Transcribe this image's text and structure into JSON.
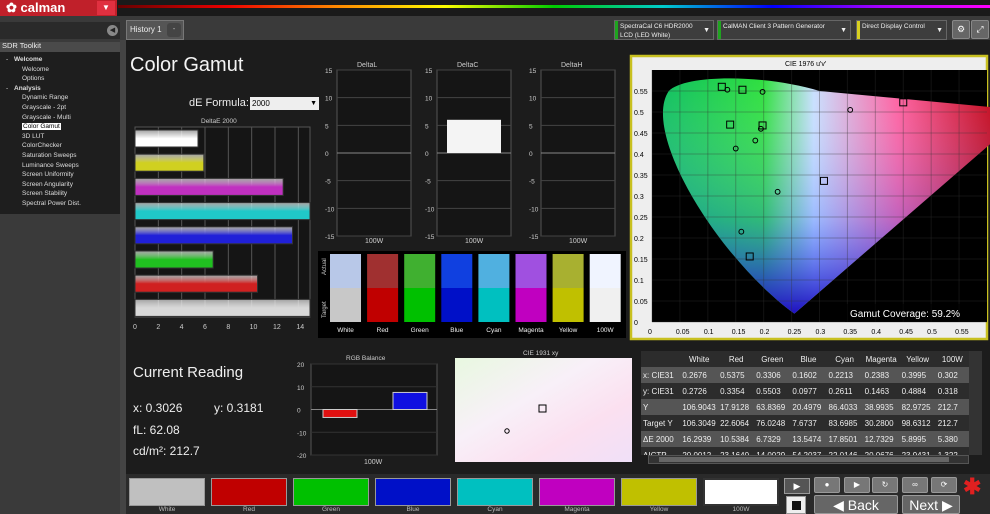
{
  "app": {
    "name": "calman"
  },
  "header": {
    "tab": "History 1",
    "tab_close": "-",
    "devices": [
      {
        "line1": "SpectraCal C6 HDR2000",
        "line2": "LCD (LED White)",
        "color": "#1fa31f"
      },
      {
        "line1": "CalMAN Client 3 Pattern Generator",
        "line2": "",
        "color": "#1fa31f"
      },
      {
        "line1": "Direct Display Control",
        "line2": "",
        "color": "#d8d020"
      }
    ]
  },
  "sidebar": {
    "title": "SDR Toolkit",
    "items": [
      {
        "label": "Welcome",
        "level": 0,
        "bold": true
      },
      {
        "label": "Welcome",
        "level": 1
      },
      {
        "label": "Options",
        "level": 1
      },
      {
        "label": "Analysis",
        "level": 0,
        "bold": true
      },
      {
        "label": "Dynamic Range",
        "level": 1
      },
      {
        "label": "Grayscale - 2pt",
        "level": 1
      },
      {
        "label": "Grayscale - Multi",
        "level": 1
      },
      {
        "label": "Color Gamut",
        "level": 1,
        "selected": true
      },
      {
        "label": "3D LUT",
        "level": 1
      },
      {
        "label": "ColorChecker",
        "level": 1
      },
      {
        "label": "Saturation Sweeps",
        "level": 1
      },
      {
        "label": "Luminance Sweeps",
        "level": 1
      },
      {
        "label": "Screen Uniformity",
        "level": 1
      },
      {
        "label": "Screen Angularity",
        "level": 1
      },
      {
        "label": "Screen Stability",
        "level": 1
      },
      {
        "label": "Spectral Power Dist.",
        "level": 1
      }
    ]
  },
  "page": {
    "title": "Color Gamut",
    "de_formula_label": "dE Formula:",
    "de_formula_value": "2000"
  },
  "charts": {
    "deltae": {
      "title": "DeltaE 2000",
      "ticks": [
        "0",
        "2",
        "4",
        "6",
        "8",
        "10",
        "12",
        "14"
      ],
      "xlim": [
        0,
        15
      ],
      "bars": [
        {
          "v": 5.4,
          "c": "#ffffff"
        },
        {
          "v": 5.9,
          "c": "#d0d020"
        },
        {
          "v": 12.7,
          "c": "#c030c0"
        },
        {
          "v": 17.9,
          "c": "#20c8c8"
        },
        {
          "v": 13.5,
          "c": "#2020d8"
        },
        {
          "v": 6.7,
          "c": "#20c020"
        },
        {
          "v": 10.5,
          "c": "#d02020"
        },
        {
          "v": 16.3,
          "c": "#d8d8d8"
        }
      ]
    },
    "delta_small": [
      {
        "title": "DeltaL",
        "xlabel": "100W",
        "value": 0
      },
      {
        "title": "DeltaC",
        "xlabel": "100W",
        "value": 6
      },
      {
        "title": "DeltaH",
        "xlabel": "100W",
        "value": 0
      }
    ],
    "delta_ticks": [
      "15",
      "10",
      "5",
      "0",
      "-5",
      "-10",
      "-15"
    ],
    "rgb": {
      "title": "RGB Balance",
      "xlabel": "100W",
      "ticks": [
        "20",
        "10",
        "0",
        "-10",
        "-20"
      ],
      "bars": [
        {
          "v": -3.5,
          "c": "#e01010"
        },
        {
          "v": 7.5,
          "c": "#1010e0"
        }
      ]
    },
    "cie1976": {
      "title": "CIE 1976 u'v'",
      "xticks": [
        "0",
        "0.05",
        "0.1",
        "0.15",
        "0.2",
        "0.25",
        "0.3",
        "0.35",
        "0.4",
        "0.45",
        "0.5",
        "0.55"
      ],
      "yticks": [
        "0.55",
        "0.5",
        "0.45",
        "0.4",
        "0.35",
        "0.3",
        "0.25",
        "0.2",
        "0.15",
        "0.1",
        "0.05",
        "0"
      ],
      "coverage_label": "Gamut Coverage:",
      "coverage_value": "59.2%"
    },
    "cie1931": {
      "title": "CIE 1931 xy"
    }
  },
  "swatch_compare": {
    "actual_label": "Actual",
    "target_label": "Target",
    "items": [
      {
        "label": "White",
        "actual": "#b8c8e8",
        "target": "#c8c8c8"
      },
      {
        "label": "Red",
        "actual": "#a03030",
        "target": "#c00000"
      },
      {
        "label": "Green",
        "actual": "#40b030",
        "target": "#00c000"
      },
      {
        "label": "Blue",
        "actual": "#1040e0",
        "target": "#0010c8"
      },
      {
        "label": "Cyan",
        "actual": "#50b0e0",
        "target": "#00c0c0"
      },
      {
        "label": "Magenta",
        "actual": "#a050e0",
        "target": "#c000c0"
      },
      {
        "label": "Yellow",
        "actual": "#a8b030",
        "target": "#c0c000"
      },
      {
        "label": "100W",
        "actual": "#f0f4ff",
        "target": "#f0f0f0"
      }
    ]
  },
  "reading": {
    "title": "Current Reading",
    "x": "x: 0.3026",
    "y": "y: 0.3181",
    "fl": "fL: 62.08",
    "cdm": "cd/m²: 212.7"
  },
  "table": {
    "headers": [
      "",
      "White",
      "Red",
      "Green",
      "Blue",
      "Cyan",
      "Magenta",
      "Yellow",
      "100W"
    ],
    "rows": [
      [
        "x: CIE31",
        "0.2676",
        "0.5375",
        "0.3306",
        "0.1602",
        "0.2213",
        "0.2383",
        "0.3995",
        "0.302"
      ],
      [
        "y: CIE31",
        "0.2726",
        "0.3354",
        "0.5503",
        "0.0977",
        "0.2611",
        "0.1463",
        "0.4884",
        "0.318"
      ],
      [
        "Y",
        "106.9043",
        "17.9128",
        "63.8369",
        "20.4979",
        "86.4033",
        "38.9935",
        "82.9725",
        "212.7"
      ],
      [
        "Target Y",
        "106.3049",
        "22.6064",
        "76.0248",
        "7.6737",
        "83.6985",
        "30.2800",
        "98.6312",
        "212.7"
      ],
      [
        "ΔE 2000",
        "16.2939",
        "10.5384",
        "6.7329",
        "13.5474",
        "17.8501",
        "12.7329",
        "5.8995",
        "5.380"
      ],
      [
        "ΔICTP",
        "20.0012",
        "23.1640",
        "14.0029",
        "54.2037",
        "22.0146",
        "20.0676",
        "23.9431",
        "1.322"
      ]
    ]
  },
  "bottom": {
    "swatches": [
      {
        "label": "White",
        "color": "#c0c0c0"
      },
      {
        "label": "Red",
        "color": "#c00000"
      },
      {
        "label": "Green",
        "color": "#00c000"
      },
      {
        "label": "Blue",
        "color": "#0010c8"
      },
      {
        "label": "Cyan",
        "color": "#00c0c0"
      },
      {
        "label": "Magenta",
        "color": "#c000c0"
      },
      {
        "label": "Yellow",
        "color": "#c0c000"
      },
      {
        "label": "100W",
        "color": "#ffffff"
      }
    ],
    "back": "Back",
    "next": "Next"
  }
}
